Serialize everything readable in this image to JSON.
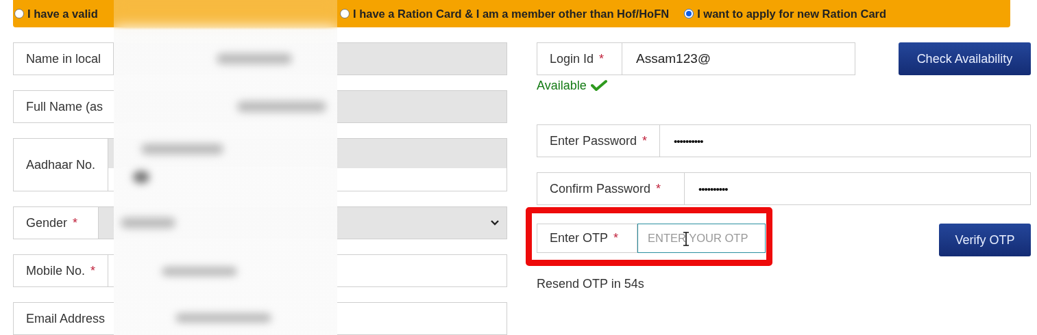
{
  "options": [
    {
      "label": "I have a valid",
      "selected": false
    },
    {
      "label": "I have a Ration Card & I am a member other than Hof/HoFN",
      "selected": false
    },
    {
      "label": "I want to apply for new Ration Card",
      "selected": true
    }
  ],
  "left_fields": [
    {
      "kind": "text",
      "label": "Name in local",
      "disabled": true
    },
    {
      "kind": "text",
      "label": "Full Name (as",
      "disabled": true
    },
    {
      "kind": "stacked",
      "label": "Aadhaar No.",
      "disabled": true
    },
    {
      "kind": "select",
      "label": "Gender",
      "required_mark": "*",
      "disabled": true
    },
    {
      "kind": "text",
      "label": "Mobile No.",
      "required_mark": "*",
      "disabled": false
    },
    {
      "kind": "text",
      "label": "Email Address",
      "disabled": false
    }
  ],
  "login": {
    "label": "Login Id",
    "required_mark": "*",
    "value": "Assam123@"
  },
  "check_button": "Check Availability",
  "availability": "Available",
  "password": {
    "label": "Enter Password",
    "required_mark": "*",
    "value": "••••••••••"
  },
  "confirm_password": {
    "label": "Confirm Password",
    "required_mark": "*",
    "value": "••••••••••"
  },
  "otp": {
    "label": "Enter OTP",
    "required_mark": "*",
    "placeholder": "ENTER YOUR OTP",
    "highlighted": true
  },
  "verify_button": "Verify OTP",
  "resend": "Resend OTP in 54s"
}
